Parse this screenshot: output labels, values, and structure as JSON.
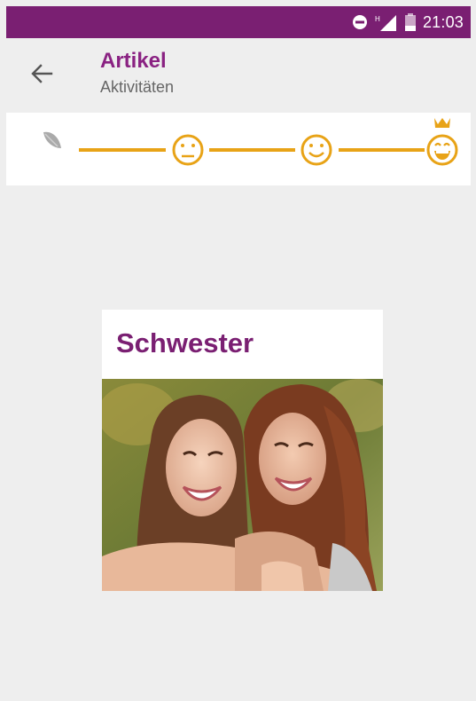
{
  "status_bar": {
    "time": "21:03",
    "icons": [
      "do-not-disturb-icon",
      "signal-icon",
      "battery-icon"
    ],
    "background": "#7a1f72"
  },
  "app_bar": {
    "back_icon": "arrow-back-icon",
    "title": "Artikel",
    "subtitle": "Aktivitäten",
    "title_color": "#8a2282"
  },
  "progress": {
    "accent": "#e8a317",
    "steps": [
      {
        "icon": "leaf-icon",
        "state": "start"
      },
      {
        "icon": "neutral-face-icon",
        "state": "reached"
      },
      {
        "icon": "smiling-face-icon",
        "state": "reached"
      },
      {
        "icon": "grinning-face-crown-icon",
        "state": "goal"
      }
    ]
  },
  "card": {
    "title": "Schwester",
    "image": "photo-two-women-hugging"
  }
}
